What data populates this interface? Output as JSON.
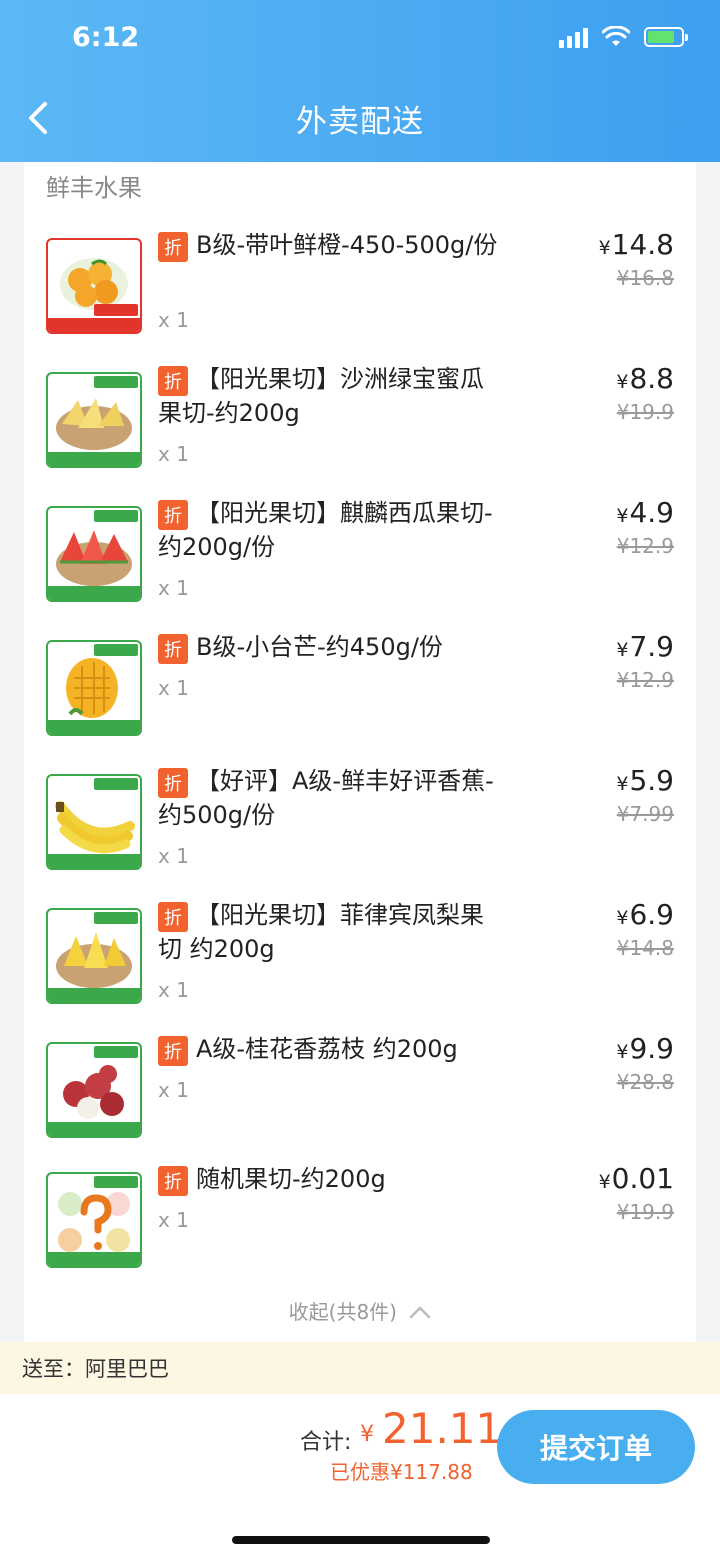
{
  "status_bar": {
    "time": "6:12"
  },
  "header": {
    "title": "外卖配送"
  },
  "shop": {
    "name": "鲜丰水果"
  },
  "items": [
    {
      "tag": "折",
      "name": "B级-带叶鲜橙-450-500g/份",
      "qty": "x 1",
      "currency": "¥",
      "price": "14.8",
      "original_price": "¥16.8"
    },
    {
      "tag": "折",
      "name": "【阳光果切】沙洲绿宝蜜瓜果切-约200g",
      "qty": "x 1",
      "currency": "¥",
      "price": "8.8",
      "original_price": "¥19.9"
    },
    {
      "tag": "折",
      "name": "【阳光果切】麒麟西瓜果切-约200g/份",
      "qty": "x 1",
      "currency": "¥",
      "price": "4.9",
      "original_price": "¥12.9"
    },
    {
      "tag": "折",
      "name": "B级-小台芒-约450g/份",
      "qty": "x 1",
      "currency": "¥",
      "price": "7.9",
      "original_price": "¥12.9"
    },
    {
      "tag": "折",
      "name": "【好评】A级-鲜丰好评香蕉-约500g/份",
      "qty": "x 1",
      "currency": "¥",
      "price": "5.9",
      "original_price": "¥7.99"
    },
    {
      "tag": "折",
      "name": "【阳光果切】菲律宾凤梨果切 约200g",
      "qty": "x 1",
      "currency": "¥",
      "price": "6.9",
      "original_price": "¥14.8"
    },
    {
      "tag": "折",
      "name": "A级-桂花香荔枝 约200g",
      "qty": "x 1",
      "currency": "¥",
      "price": "9.9",
      "original_price": "¥28.8"
    },
    {
      "tag": "折",
      "name": "随机果切-约200g",
      "qty": "x 1",
      "currency": "¥",
      "price": "0.01",
      "original_price": "¥19.9"
    }
  ],
  "collapse": {
    "label": "收起(共8件)"
  },
  "address": {
    "label": "送至：阿里巴巴"
  },
  "footer": {
    "total_label": "合计:",
    "currency": "¥",
    "total": "21.11",
    "saved": "已优惠¥117.88",
    "submit_label": "提交订单"
  },
  "colors": {
    "header_blue": "#48aeef",
    "accent_orange": "#f2622e",
    "promo_green": "#3aa84b"
  }
}
